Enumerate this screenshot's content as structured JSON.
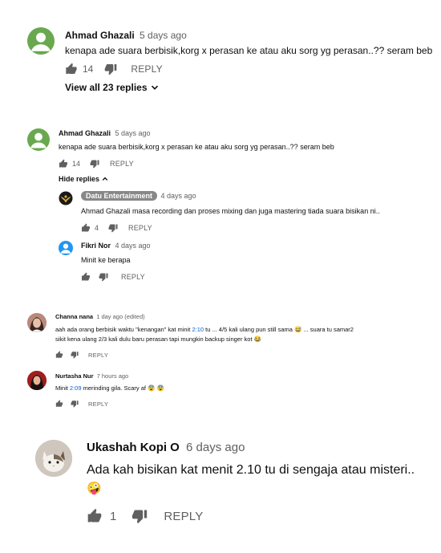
{
  "c1": {
    "author": "Ahmad Ghazali",
    "time": "5 days ago",
    "text": "kenapa ade suara berbisik,korg x perasan ke atau aku sorg yg perasan..?? seram beb",
    "likes": "14",
    "reply": "REPLY",
    "view_replies": "View all 23 replies"
  },
  "c2": {
    "author": "Ahmad Ghazali",
    "time": "5 days ago",
    "text": "kenapa ade suara berbisik,korg x perasan ke atau aku sorg yg perasan..?? seram beb",
    "likes": "14",
    "reply": "REPLY",
    "hide_replies": "Hide replies",
    "replies": [
      {
        "author": "Datu Entertainment",
        "time": "4 days ago",
        "text": "Ahmad Ghazali masa recording dan proses mixing dan juga mastering tiada suara bisikan ni..",
        "likes": "4",
        "reply": "REPLY"
      },
      {
        "author": "Fikri Nor",
        "time": "4 days ago",
        "text": "Minit ke berapa",
        "reply": "REPLY"
      }
    ]
  },
  "c3": {
    "author": "Channa nana",
    "time": "1 day ago (edited)",
    "text_a": "aah ada orang berbisik waktu \"kenangan\" kat minit ",
    "timestamp": "2:10",
    "text_b": " tu ... 4/5 kali ulang pun still sama 😅 ... suara tu samar2",
    "text_line2": "sikit kena ulang 2/3 kali dulu baru perasan tapi mungkin backup singer kot 😂",
    "reply": "REPLY"
  },
  "c4": {
    "author": "Nurtasha Nur",
    "time": "7 hours ago",
    "text_a": "Minit ",
    "timestamp": "2:09",
    "text_b": " merinding gila. Scary af 😨 😨",
    "reply": "REPLY"
  },
  "c5": {
    "author": "Ukashah Kopi O",
    "time": "6 days ago",
    "text": "Ada kah bisikan kat menit 2.10 tu di sengaja atau misteri..",
    "emoji": "🤪",
    "likes": "1",
    "reply": "REPLY"
  },
  "colors": {
    "avatar_green": "#6aa84f",
    "avatar_blue": "#2196f3",
    "link": "#065fd4",
    "muted": "#606060"
  }
}
